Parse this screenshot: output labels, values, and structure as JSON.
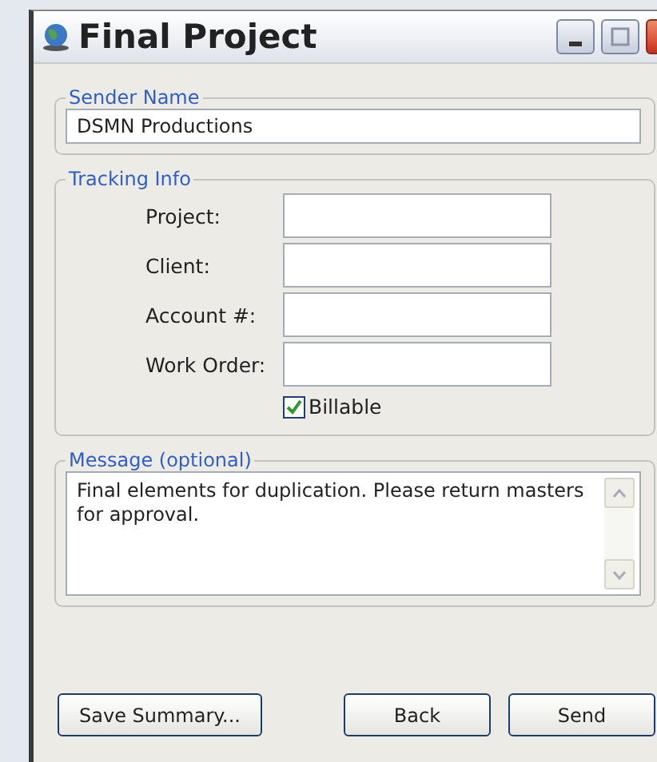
{
  "window": {
    "title": "Final Project"
  },
  "sender": {
    "legend": "Sender Name",
    "value": "DSMN Productions"
  },
  "tracking": {
    "legend": "Tracking Info",
    "fields": [
      {
        "label": "Project:"
      },
      {
        "label": "Client:"
      },
      {
        "label": "Account #:"
      },
      {
        "label": "Work Order:"
      }
    ],
    "billable": {
      "label": "Billable",
      "checked": true
    }
  },
  "message": {
    "legend": "Message (optional)",
    "value": "Final elements for duplication. Please return masters for approval."
  },
  "buttons": [
    {
      "label": "Save Summary..."
    },
    {
      "label": "Back"
    },
    {
      "label": "Send"
    }
  ]
}
